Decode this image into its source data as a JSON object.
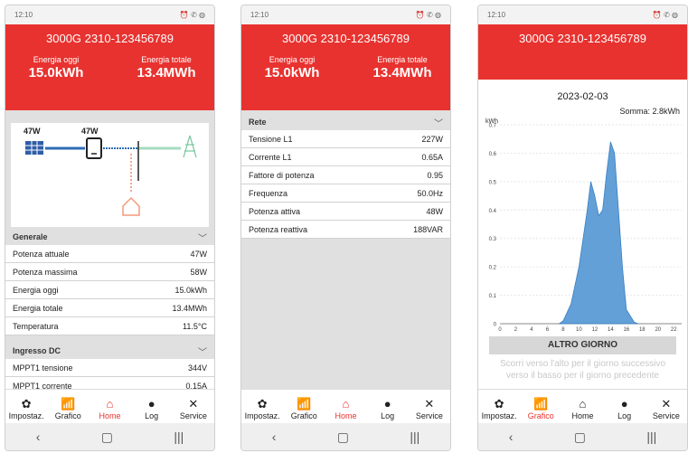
{
  "status": {
    "time": "12:10",
    "icons": "⏰ ✆ ◍"
  },
  "device": "3000G 2310-123456789",
  "today_label": "Energia oggi",
  "today_value": "15.0kWh",
  "total_label": "Energia totale",
  "total_value": "13.4MWh",
  "flow": {
    "pv_power": "47W",
    "inv_power": "47W"
  },
  "general": {
    "title": "Generale",
    "rows": [
      {
        "label": "Potenza attuale",
        "value": "47W"
      },
      {
        "label": "Potenza massima",
        "value": "58W"
      },
      {
        "label": "Energia oggi",
        "value": "15.0kWh"
      },
      {
        "label": "Energia totale",
        "value": "13.4MWh"
      },
      {
        "label": "Temperatura",
        "value": "11.5°C"
      }
    ]
  },
  "dc": {
    "title": "Ingresso DC",
    "rows": [
      {
        "label": "MPPT1 tensione",
        "value": "344V"
      },
      {
        "label": "MPPT1 corrente",
        "value": "0.15A"
      }
    ]
  },
  "grid": {
    "title": "Rete",
    "rows": [
      {
        "label": "Tensione L1",
        "value": "227W"
      },
      {
        "label": "Corrente L1",
        "value": "0.65A"
      },
      {
        "label": "Fattore di potenza",
        "value": "0.95"
      },
      {
        "label": "Frequenza",
        "value": "50.0Hz"
      },
      {
        "label": "Potenza attiva",
        "value": "48W"
      },
      {
        "label": "Potenza reattiva",
        "value": "188VAR"
      }
    ]
  },
  "nav": [
    "Impostaz.",
    "Grafico",
    "Home",
    "Log",
    "Service"
  ],
  "nav_icons": [
    "gear-icon",
    "chart-icon",
    "home-icon",
    "info-icon",
    "tools-icon"
  ],
  "system_nav": [
    "‹",
    "▢",
    "|||"
  ],
  "chart_screen": {
    "date": "2023-02-03",
    "sum": "Somma: 2.8kWh",
    "button": "ALTRO GIORNO",
    "hint_line1": "Scorri verso l'alto per il giorno successivo",
    "hint_line2": "verso il basso per il giorno precedente"
  },
  "chart_data": {
    "type": "area",
    "ylabel": "kWh",
    "ylim": [
      0,
      0.7
    ],
    "xlim": [
      0,
      23
    ],
    "yticks": [
      0,
      0.1,
      0.2,
      0.3,
      0.4,
      0.5,
      0.6,
      0.7
    ],
    "xticks": [
      0,
      2,
      4,
      6,
      8,
      10,
      12,
      14,
      16,
      18,
      20,
      22
    ],
    "x": [
      7.5,
      8,
      9,
      10,
      11,
      11.5,
      12,
      12.5,
      13,
      13.5,
      14,
      14.5,
      15,
      15.5,
      16,
      17,
      17.5
    ],
    "values": [
      0,
      0.01,
      0.07,
      0.2,
      0.39,
      0.5,
      0.45,
      0.38,
      0.4,
      0.53,
      0.64,
      0.6,
      0.4,
      0.2,
      0.05,
      0.005,
      0
    ],
    "color": "#5a9bd5"
  }
}
